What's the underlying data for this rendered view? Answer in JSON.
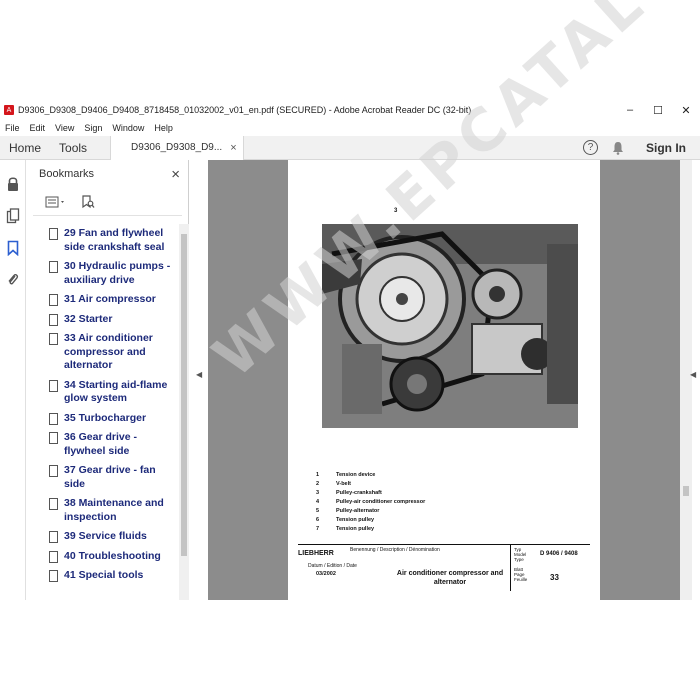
{
  "window": {
    "title": "D9306_D9308_D9406_D9408_8718458_01032002_v01_en.pdf (SECURED) - Adobe Acrobat Reader DC (32-bit)",
    "controls": {
      "minimize": "–",
      "maximize": "☐",
      "close": "✕"
    }
  },
  "menu": [
    "File",
    "Edit",
    "View",
    "Sign",
    "Window",
    "Help"
  ],
  "tabs": {
    "home": "Home",
    "tools": "Tools",
    "doc": "D9306_D9308_D9...",
    "doc_close": "×",
    "sign_in": "Sign In"
  },
  "panel": {
    "title": "Bookmarks",
    "close": "×",
    "bookmarks": [
      "29 Fan and flywheel side crankshaft seal",
      "30 Hydraulic pumps - auxiliary drive",
      "31 Air compressor",
      "32 Starter",
      "33 Air conditioner compressor and alternator",
      "34 Starting aid-flame glow system",
      "35 Turbocharger",
      "36 Gear drive - flywheel side",
      "37 Gear drive - fan side",
      "38 Maintenance and inspection",
      "39 Service fluids",
      "40 Troubleshooting",
      "41 Special tools"
    ]
  },
  "page": {
    "callout_top": "3",
    "legend": [
      {
        "n": "1",
        "t": "Tension device"
      },
      {
        "n": "2",
        "t": "V-belt"
      },
      {
        "n": "3",
        "t": "Pulley-crankshaft"
      },
      {
        "n": "4",
        "t": "Pulley-air conditioner compressor"
      },
      {
        "n": "5",
        "t": "Pulley-alternator"
      },
      {
        "n": "6",
        "t": "Tension pulley"
      },
      {
        "n": "7",
        "t": "Tension pulley"
      }
    ],
    "footer": {
      "brand": "LIEBHERR",
      "desc_label": "Benennung / Description / Dénomination",
      "date_label": "Datum / Edition / Date",
      "date": "03/2002",
      "title": "Air conditioner compressor and alternator",
      "typ_label": "Typ",
      "model_label": "Model",
      "type_label": "Type",
      "model": "D 9406 / 9408",
      "blatt_label": "Blatt",
      "page_label": "Page",
      "feuille_label": "Feuille",
      "page": "33"
    },
    "watermark": "WWW.EPCATALOG.COM"
  }
}
